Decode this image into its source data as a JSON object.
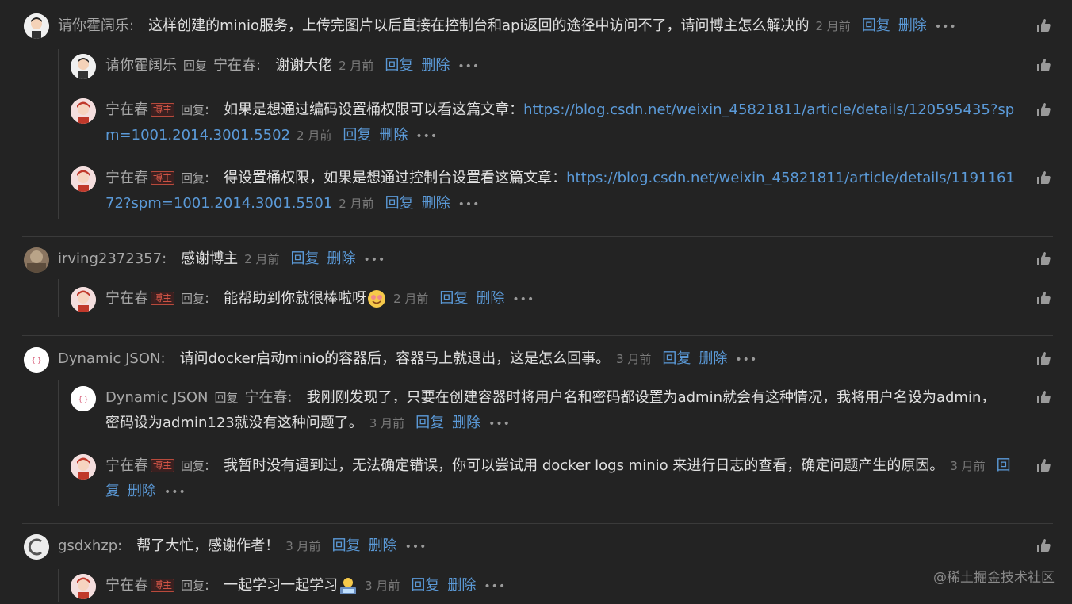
{
  "labels": {
    "reply_word": "回复",
    "reply_action": "回复",
    "delete_action": "删除",
    "author_badge": "博主",
    "more": "•••"
  },
  "watermark": "@稀土掘金技术社区",
  "threads": [
    {
      "comment": {
        "user": "请你霍阔乐",
        "text": "这样创建的minio服务，上传完图片以后直接在控制台和api返回的途径中访问不了，请问博主怎么解决的",
        "time": "2 月前"
      },
      "replies": [
        {
          "user": "请你霍阔乐",
          "target": "宁在春",
          "text": "谢谢大佬",
          "time": "2 月前"
        },
        {
          "user": "宁在春",
          "badge": true,
          "text": "如果是想通过编码设置桶权限可以看这篇文章：",
          "link": "https://blog.csdn.net/weixin_45821811/article/details/120595435?spm=1001.2014.3001.5502",
          "time": "2 月前"
        },
        {
          "user": "宁在春",
          "badge": true,
          "text": "得设置桶权限，如果是想通过控制台设置看这篇文章：",
          "link": "https://blog.csdn.net/weixin_45821811/article/details/119116172?spm=1001.2014.3001.5501",
          "time": "2 月前"
        }
      ]
    },
    {
      "comment": {
        "user": "irving2372357",
        "text": "感谢博主",
        "time": "2 月前"
      },
      "replies": [
        {
          "user": "宁在春",
          "badge": true,
          "text": "能帮助到你就很棒啦呀",
          "emoji": "happy-emoji",
          "time": "2 月前"
        }
      ]
    },
    {
      "comment": {
        "user": "Dynamic JSON",
        "text": "请问docker启动minio的容器后，容器马上就退出，这是怎么回事。",
        "time": "3 月前"
      },
      "replies": [
        {
          "user": "Dynamic JSON",
          "target": "宁在春",
          "text": "我刚刚发现了，只要在创建容器时将用户名和密码都设置为admin就会有这种情况，我将用户名设为admin，密码设为admin123就没有这种问题了。",
          "time": "3 月前"
        },
        {
          "user": "宁在春",
          "badge": true,
          "text": "我暂时没有遇到过，无法确定错误，你可以尝试用 docker logs minio 来进行日志的查看，确定问题产生的原因。",
          "time": "3 月前"
        }
      ]
    },
    {
      "comment": {
        "user": "gsdxhzp",
        "text": "帮了大忙，感谢作者！",
        "time": "3 月前"
      },
      "replies": [
        {
          "user": "宁在春",
          "badge": true,
          "text": "一起学习一起学习",
          "emoji": "coder-emoji",
          "time": "3 月前"
        }
      ]
    }
  ],
  "colors": {
    "background": "#232323",
    "link": "#5b9ad8",
    "badge": "#e05a4a"
  }
}
